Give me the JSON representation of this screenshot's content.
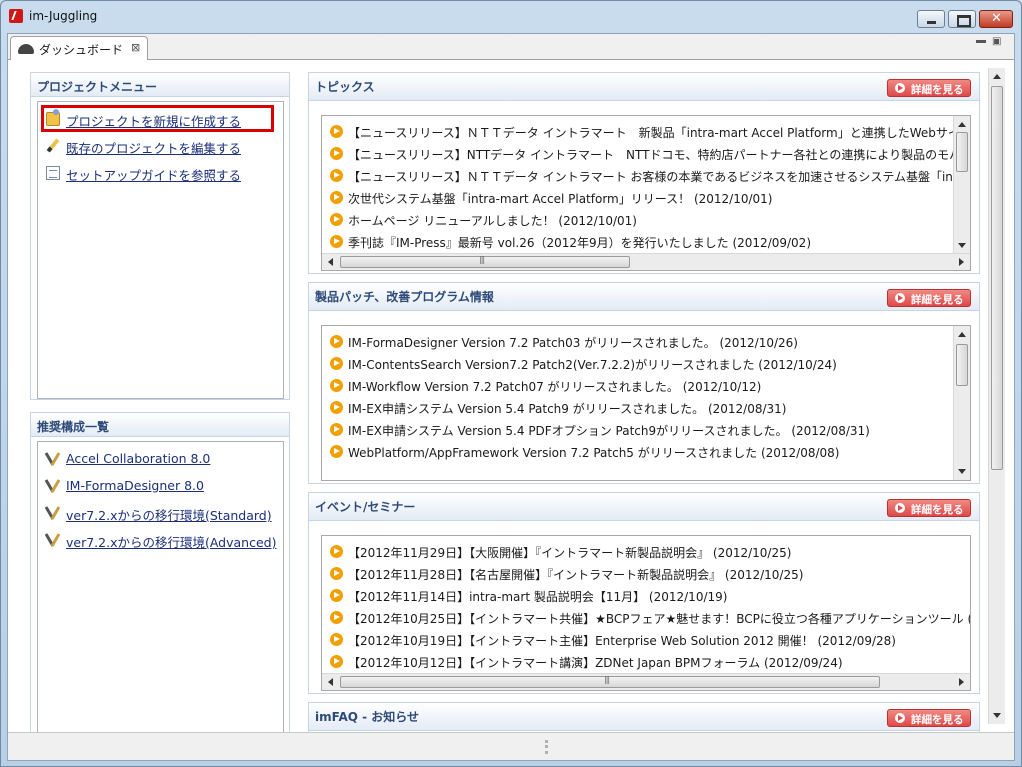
{
  "window": {
    "title": "im-Juggling",
    "minimize_label": "",
    "maximize_label": "",
    "close_label": ""
  },
  "editor_tab": {
    "label": "ダッシュボード",
    "close_glyph": "⊠"
  },
  "left": {
    "project_menu": {
      "title": "プロジェクトメニュー",
      "items": [
        {
          "label": "プロジェクトを新規に作成する",
          "icon": "new-project-icon"
        },
        {
          "label": "既存のプロジェクトを編集する",
          "icon": "edit-project-icon"
        },
        {
          "label": "セットアップガイドを参照する",
          "icon": "setup-guide-icon"
        }
      ]
    },
    "recommended": {
      "title": "推奨構成一覧",
      "items": [
        {
          "label": "Accel Collaboration 8.0"
        },
        {
          "label": "IM-FormaDesigner 8.0"
        },
        {
          "label": "ver7.2.xからの移行環境(Standard)"
        },
        {
          "label": "ver7.2.xからの移行環境(Advanced)"
        }
      ]
    }
  },
  "right": {
    "detail_label": "詳細を見る",
    "topics": {
      "title": "トピックス",
      "items": [
        "【ニュースリリース】ＮＴＴデータ イントラマート　新製品「intra-mart Accel Platform」と連携したWebサイト",
        "【ニュースリリース】NTTデータ イントラマート　NTTドコモ、特約店パートナー各社との連携により製品のモバ",
        "【ニュースリリース】ＮＴＴデータ イントラマート お客様の本業であるビジネスを加速させるシステム基盤「intr",
        "次世代システム基盤「intra-mart Accel Platform」リリース！ (2012/10/01)",
        "ホームページ リニューアルしました！ (2012/10/01)",
        "季刊誌『IM-Press』最新号 vol.26（2012年9月）を発行いたしました (2012/09/02)"
      ]
    },
    "patches": {
      "title": "製品パッチ、改善プログラム情報",
      "items": [
        "IM-FormaDesigner Version 7.2 Patch03 がリリースされました。 (2012/10/26)",
        "IM-ContentsSearch Version7.2 Patch2(Ver.7.2.2)がリリースされました (2012/10/24)",
        "IM-Workflow Version 7.2 Patch07 がリリースされました。 (2012/10/12)",
        "IM-EX申請システム Version 5.4 Patch9 がリリースされました。 (2012/08/31)",
        "IM-EX申請システム Version 5.4 PDFオプション Patch9がリリースされました。 (2012/08/31)",
        "WebPlatform/AppFramework Version 7.2 Patch5 がリリースされました (2012/08/08)"
      ]
    },
    "events": {
      "title": "イベント/セミナー",
      "items": [
        "【2012年11月29日】【大阪開催】『イントラマート新製品説明会』 (2012/10/25)",
        "【2012年11月28日】【名古屋開催】『イントラマート新製品説明会』 (2012/10/25)",
        "【2012年11月14日】intra-mart 製品説明会【11月】 (2012/10/19)",
        "【2012年10月25日】【イントラマート共催】★BCPフェア★魅せます！BCPに役立つ各種アプリケーションツール (",
        "【2012年10月19日】【イントラマート主催】Enterprise Web Solution 2012 開催！ (2012/09/28)",
        "【2012年10月12日】【イントラマート講演】ZDNet Japan BPMフォーラム (2012/09/24)"
      ]
    },
    "faq": {
      "title": "imFAQ - お知らせ"
    }
  }
}
